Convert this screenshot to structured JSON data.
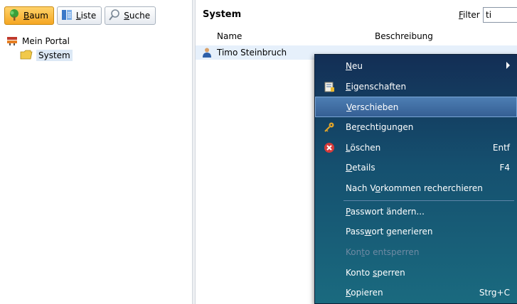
{
  "toolbar": {
    "tree": {
      "pre": "",
      "key": "B",
      "rest": "aum"
    },
    "list": {
      "pre": "",
      "key": "L",
      "rest": "iste"
    },
    "search": {
      "pre": "",
      "key": "S",
      "rest": "uche"
    }
  },
  "tree": {
    "root": "Mein Portal",
    "child": "System"
  },
  "pane": {
    "title": "System",
    "filter": {
      "pre": "",
      "key": "F",
      "rest": "ilter"
    },
    "filter_value": "ti"
  },
  "table": {
    "columns": [
      "Name",
      "Beschreibung"
    ],
    "rows": [
      {
        "name": "Timo Steinbruch"
      }
    ]
  },
  "menu": {
    "items": [
      {
        "pre": "",
        "key": "N",
        "rest": "eu",
        "shortcut": ""
      },
      {
        "pre": "",
        "key": "E",
        "rest": "igenschaften",
        "shortcut": ""
      },
      {
        "pre": "",
        "key": "V",
        "rest": "erschieben",
        "shortcut": ""
      },
      {
        "pre": "Be",
        "key": "r",
        "rest": "echtigungen",
        "shortcut": ""
      },
      {
        "pre": "",
        "key": "L",
        "rest": "öschen",
        "shortcut": "Entf"
      },
      {
        "pre": "",
        "key": "D",
        "rest": "etails",
        "shortcut": "F4"
      },
      {
        "pre": "Nach V",
        "key": "o",
        "rest": "rkommen recherchieren",
        "shortcut": ""
      },
      {
        "pre": "",
        "key": "P",
        "rest": "asswort ändern...",
        "shortcut": ""
      },
      {
        "pre": "Pass",
        "key": "w",
        "rest": "ort generieren",
        "shortcut": ""
      },
      {
        "pre": "Kon",
        "key": "t",
        "rest": "o entsperren",
        "shortcut": ""
      },
      {
        "pre": "Konto ",
        "key": "s",
        "rest": "perren",
        "shortcut": ""
      },
      {
        "pre": "",
        "key": "K",
        "rest": "opieren",
        "shortcut": "Strg+C"
      }
    ]
  },
  "icons": {
    "tree_button": "tree-icon",
    "list_button": "list-icon",
    "search_button": "magnifier-icon",
    "root": "portal-icon",
    "folder": "folder-icon",
    "user": "user-icon",
    "properties": "properties-icon",
    "permissions": "key-icon",
    "delete": "delete-icon"
  },
  "colors": {
    "menu_top": "#132e55",
    "menu_bottom": "#1a6a7f",
    "menu_highlight": "#4d7eb3",
    "active_button": "#f5a623",
    "selection": "#e6f0fb"
  }
}
